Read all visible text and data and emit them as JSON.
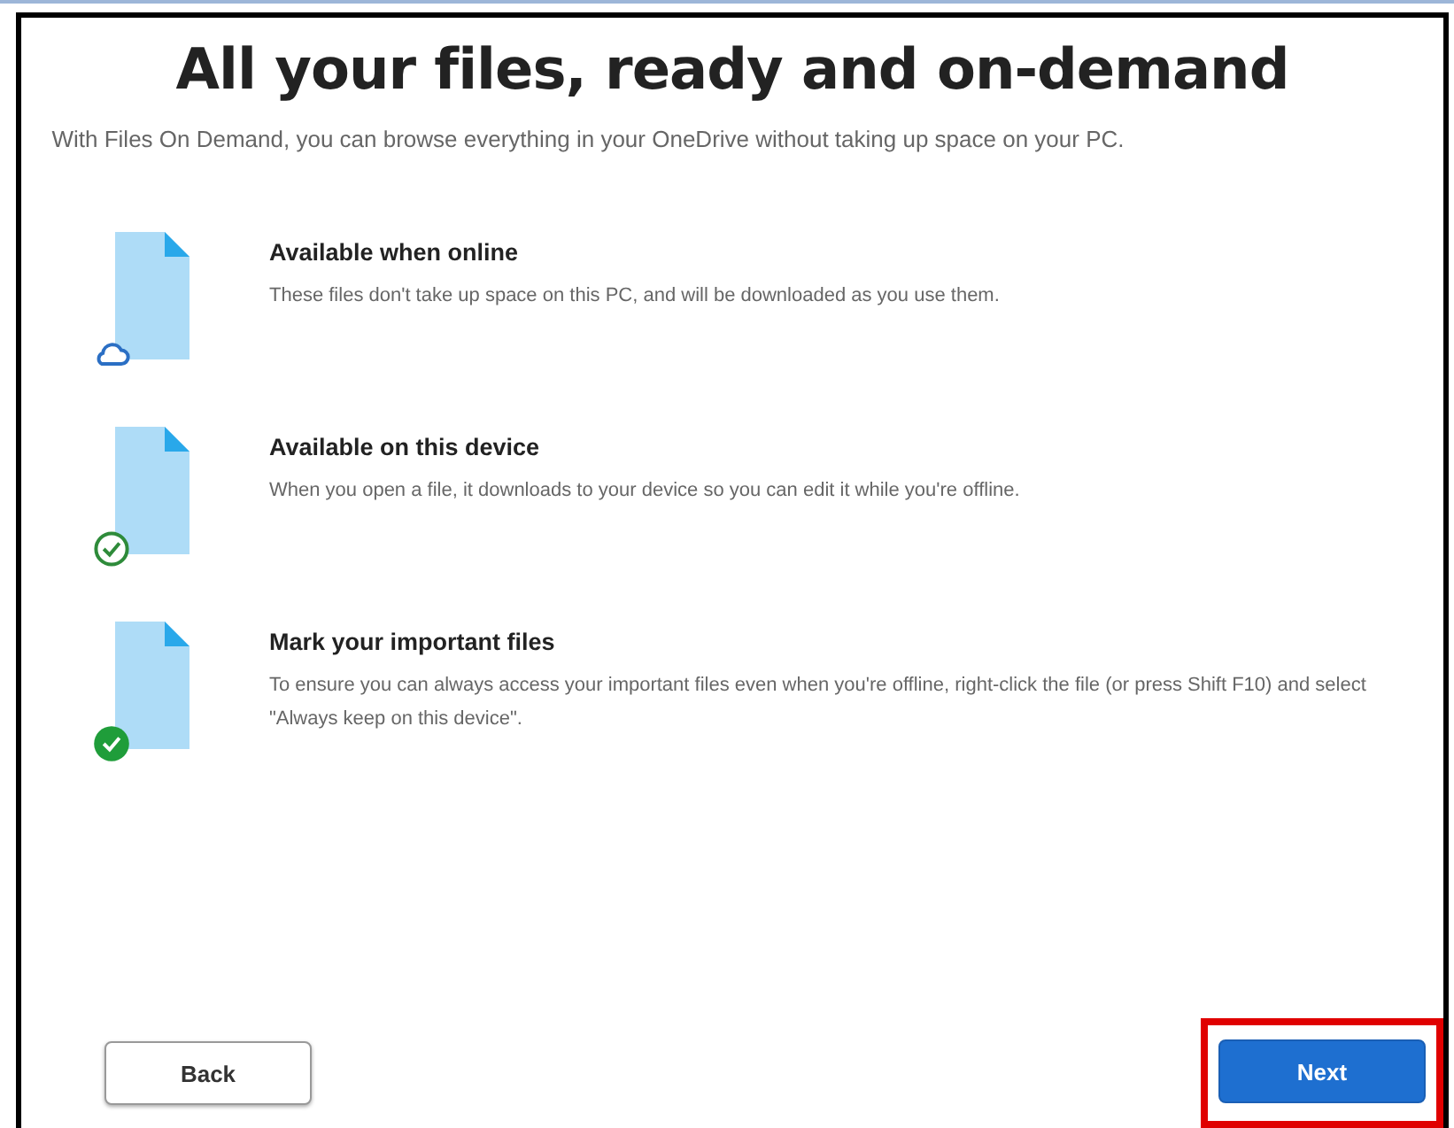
{
  "title": "All your files, ready and on-demand",
  "subtitle": "With Files On Demand, you can browse everything in your OneDrive without taking up space on your PC.",
  "items": [
    {
      "kind": "online",
      "heading": "Available when online",
      "text": "These files don't take up space on this PC, and will be downloaded as you use them."
    },
    {
      "kind": "device",
      "heading": "Available on this device",
      "text": "When you open a file, it downloads to your device so you can edit it while you're offline."
    },
    {
      "kind": "always",
      "heading": "Mark your important files",
      "text": "To ensure you can always access your important files even when you're offline, right-click the file (or press Shift F10) and select \"Always keep on this device\"."
    }
  ],
  "buttons": [
    {
      "label": "Back",
      "kind": "secondary",
      "highlighted": false
    },
    {
      "label": "Next",
      "kind": "primary",
      "highlighted": true
    }
  ]
}
